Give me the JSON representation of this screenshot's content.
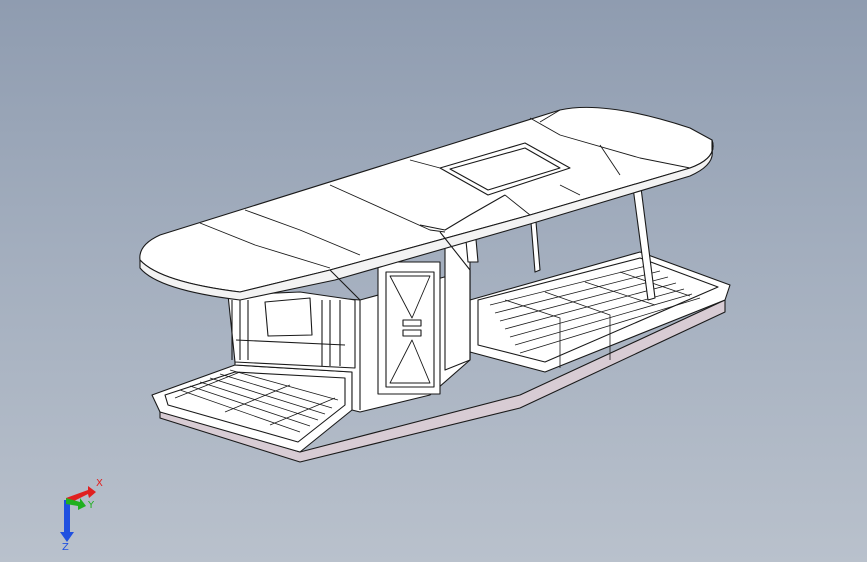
{
  "viewport": {
    "background_top": "#8f9cb0",
    "background_bottom": "#b9c1cc"
  },
  "model": {
    "icon": "houseboat-model-icon",
    "fill": "#ffffff",
    "edge": "#1a1a1a",
    "hull_shade": "#d8ccd4"
  },
  "triad": {
    "x_label": "X",
    "y_label": "Y",
    "z_label": "Z",
    "x_color": "#e02020",
    "y_color": "#20b020",
    "z_color": "#2050e0"
  }
}
